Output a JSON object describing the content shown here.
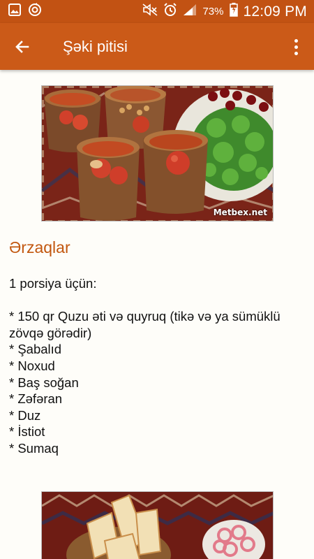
{
  "status_bar": {
    "battery": "73%",
    "time": "12:09 PM"
  },
  "app_bar": {
    "title": "Şəki pitisi"
  },
  "photo1": {
    "watermark": "Metbex.net"
  },
  "ingredients": {
    "heading": "Ərzaqlar",
    "portion": "1 porsiya üçün:",
    "item1_line1": "* 150 qr Quzu əti və quyruq (tikə və ya sümüklü",
    "item1_line2": "zövqə görədir)",
    "items": [
      "* Şabalıd",
      "* Noxud",
      "* Baş soğan",
      "* Zəfəran",
      "* Duz",
      "* İstiot",
      "* Sumaq"
    ]
  },
  "colors": {
    "status_bar": "#c25213",
    "app_bar": "#cb5a18",
    "heading": "#c2570f",
    "background": "#fefdf9"
  }
}
